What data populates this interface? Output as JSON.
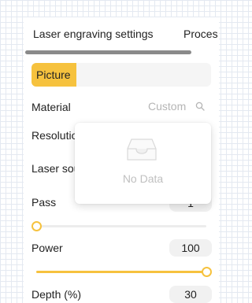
{
  "tabs": [
    {
      "label": "Laser engraving settings",
      "active": true
    },
    {
      "label": "Proces",
      "active": false
    }
  ],
  "mode": {
    "selected": "Picture"
  },
  "material": {
    "label": "Material",
    "value": "Custom"
  },
  "resolution": {
    "label": "Resolution"
  },
  "laser_source": {
    "label": "Laser source"
  },
  "pass": {
    "label": "Pass",
    "value": "1",
    "slider_fraction": 0.0
  },
  "power": {
    "label": "Power",
    "value": "100",
    "slider_fraction": 1.0
  },
  "depth": {
    "label": "Depth (%)",
    "value": "30"
  },
  "dropdown": {
    "empty_text": "No Data"
  },
  "colors": {
    "accent": "#f6c23e",
    "panel_bg": "#ffffff",
    "muted_text": "#b5b5b5"
  }
}
